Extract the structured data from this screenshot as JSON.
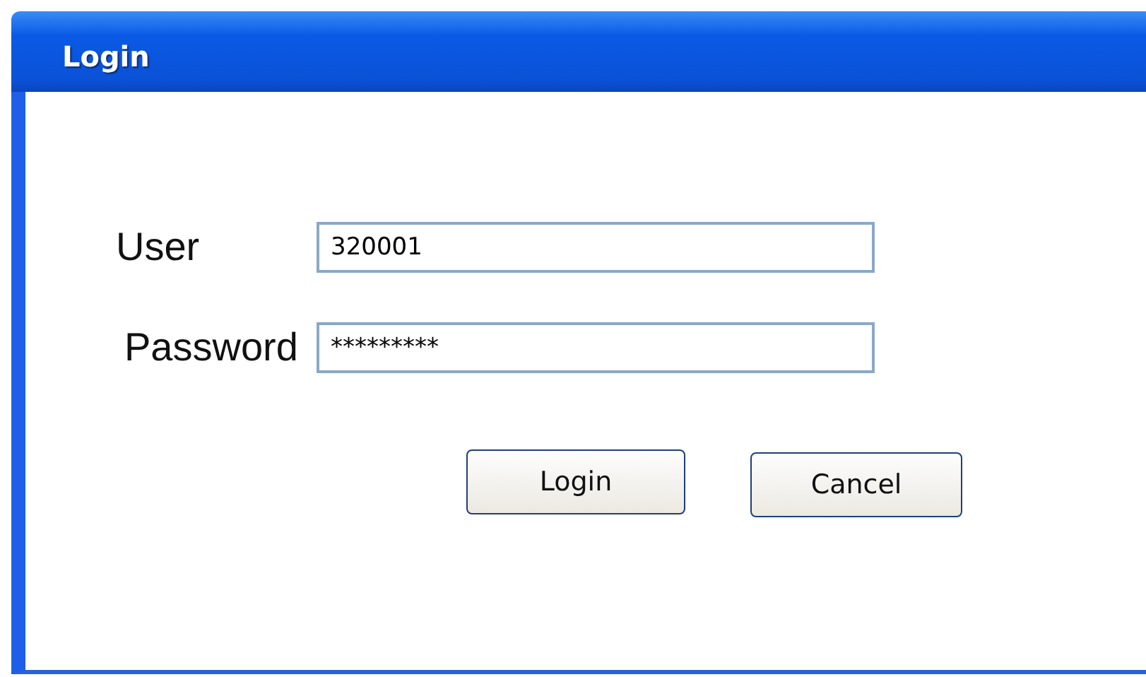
{
  "window": {
    "title": "Login"
  },
  "fields": [
    {
      "label": "User",
      "value": "320001"
    },
    {
      "label": "Password",
      "value": "*********"
    }
  ],
  "buttons": [
    "Login",
    "Cancel"
  ]
}
